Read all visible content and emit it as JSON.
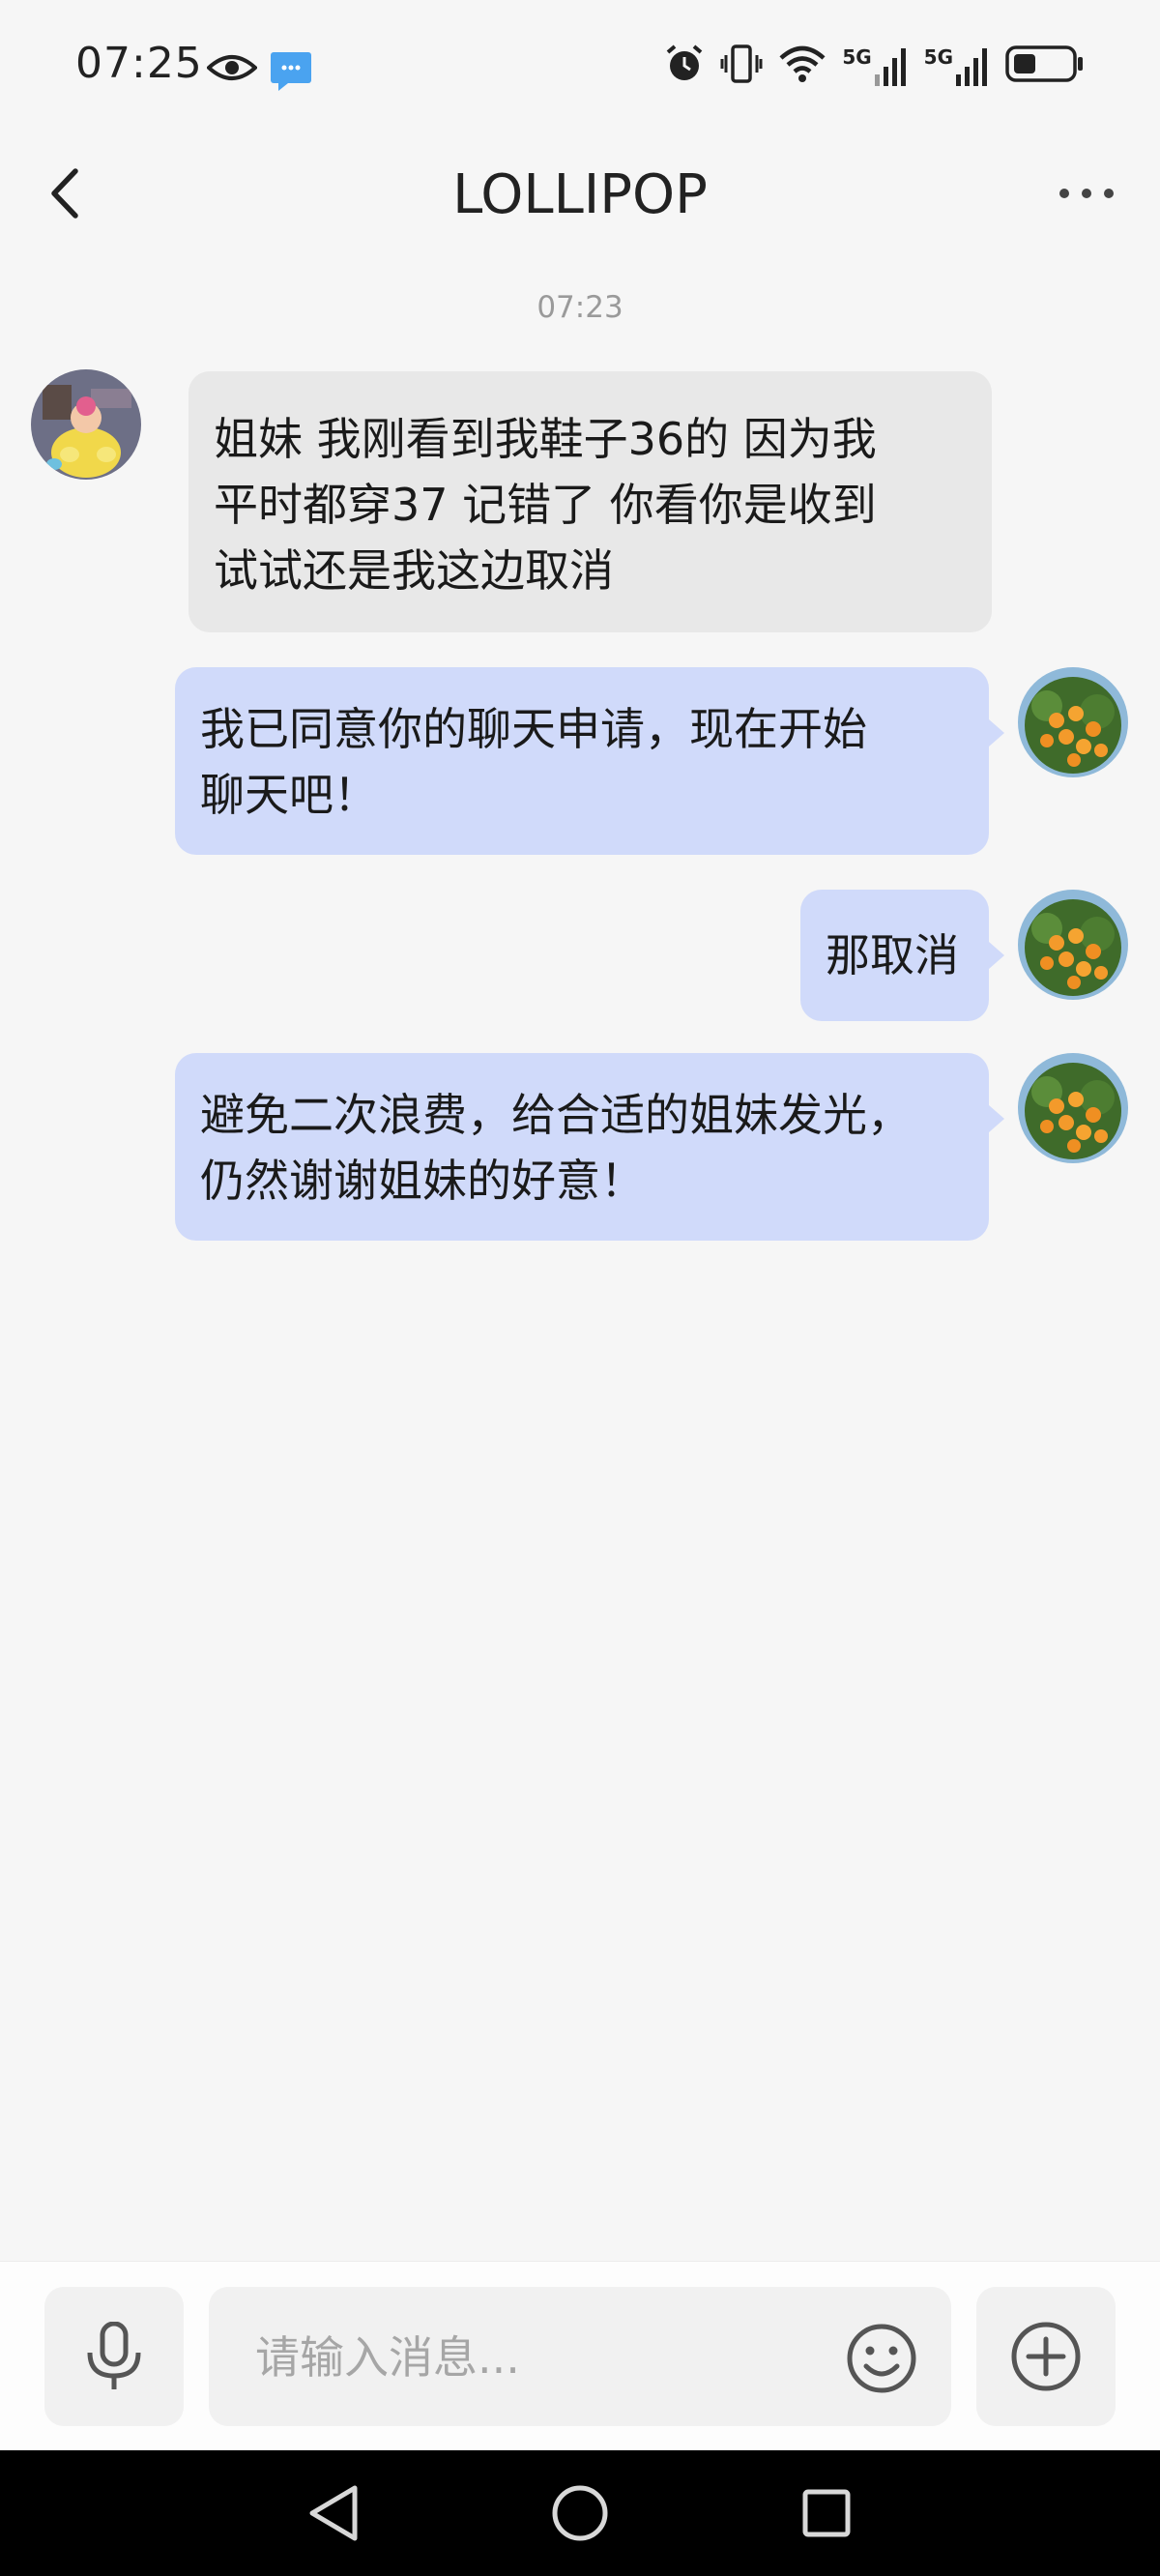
{
  "status_bar": {
    "time": "07:25",
    "icons": [
      "eye-icon",
      "message-notification-icon",
      "alarm-icon",
      "vibrate-icon",
      "wifi-icon",
      "signal-5g-icon",
      "signal-5g-icon",
      "battery-icon"
    ],
    "network_labels": [
      "5G",
      "5G"
    ]
  },
  "header": {
    "title": "LOLLIPOP",
    "back_icon": "chevron-left-icon",
    "more_icon": "more-dots-icon"
  },
  "conversation": {
    "timestamp": "07:23",
    "messages": [
      {
        "sender": "other",
        "avatar": "cartoon-avatar",
        "lines": [
          "姐妹 我刚看到我鞋子36的 因为我",
          "平时都穿37 记错了 你看你是收到",
          "试试还是我这边取消"
        ]
      },
      {
        "sender": "self",
        "avatar": "orange-tree-avatar",
        "lines": [
          "我已同意你的聊天申请，现在开始",
          "聊天吧！"
        ]
      },
      {
        "sender": "self",
        "avatar": "orange-tree-avatar",
        "lines": [
          "那取消"
        ]
      },
      {
        "sender": "self",
        "avatar": "orange-tree-avatar",
        "lines": [
          "避免二次浪费，给合适的姐妹发光，",
          "仍然谢谢姐妹的好意！"
        ]
      }
    ]
  },
  "input_bar": {
    "placeholder": "请输入消息...",
    "value": "",
    "voice_icon": "microphone-icon",
    "emoji_icon": "emoji-icon",
    "plus_icon": "plus-circle-icon"
  },
  "nav_bar": {
    "icons": [
      "back-triangle-icon",
      "home-circle-icon",
      "recents-square-icon"
    ]
  },
  "colors": {
    "background": "#f6f6f6",
    "incoming_bubble": "#e8e8e8",
    "outgoing_bubble": "#d0dafa",
    "nav_bar": "#000000"
  }
}
